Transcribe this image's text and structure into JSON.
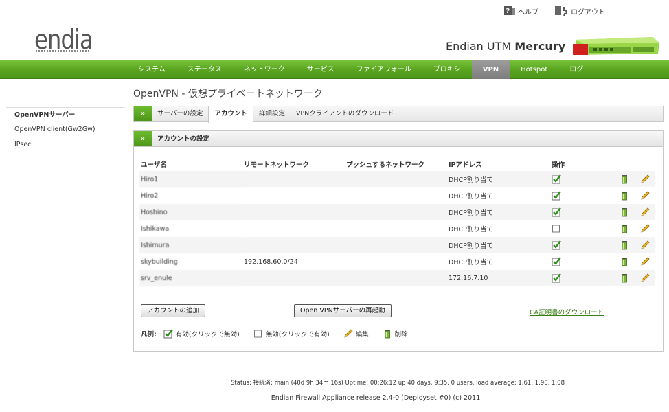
{
  "header": {
    "help_label": "ヘルプ",
    "logout_label": "ログアウト",
    "logo_text": "endian",
    "product_prefix": "Endian UTM",
    "product_name": "Mercury"
  },
  "nav": {
    "items": [
      {
        "label": "システム"
      },
      {
        "label": "ステータス"
      },
      {
        "label": "ネットワーク"
      },
      {
        "label": "サービス"
      },
      {
        "label": "ファイアウォール"
      },
      {
        "label": "プロキシ"
      },
      {
        "label": "VPN",
        "active": true
      },
      {
        "label": "Hotspot"
      },
      {
        "label": "ログ"
      }
    ]
  },
  "page_title": "OpenVPN - 仮想プライベートネットワーク",
  "sidebar": {
    "items": [
      {
        "label": "OpenVPNサーバー",
        "active": true
      },
      {
        "label": "OpenVPN client(Gw2Gw)"
      },
      {
        "label": "IPsec"
      }
    ]
  },
  "tabs": {
    "arrow": "»",
    "items": [
      {
        "label": "サーバーの設定"
      },
      {
        "label": "アカウント",
        "active": true
      },
      {
        "label": "詳細設定"
      },
      {
        "label": "VPNクライアントのダウンロード"
      }
    ]
  },
  "panel": {
    "title": "アカウントの設定",
    "columns": [
      "ユーザ名",
      "リモートネットワーク",
      "プッシュするネットワーク",
      "IPアドレス",
      "操作"
    ],
    "rows": [
      {
        "user": "Hiro1",
        "remote": "",
        "push": "",
        "ip": "DHCP割り当て",
        "enabled": true
      },
      {
        "user": "Hiro2",
        "remote": "",
        "push": "",
        "ip": "DHCP割り当て",
        "enabled": true
      },
      {
        "user": "Hoshino",
        "remote": "",
        "push": "",
        "ip": "DHCP割り当て",
        "enabled": true
      },
      {
        "user": "Ishikawa",
        "remote": "",
        "push": "",
        "ip": "DHCP割り当て",
        "enabled": false
      },
      {
        "user": "Ishimura",
        "remote": "",
        "push": "",
        "ip": "DHCP割り当て",
        "enabled": true
      },
      {
        "user": "skybuilding",
        "remote": "192.168.60.0/24",
        "push": "",
        "ip": "DHCP割り当て",
        "enabled": true
      },
      {
        "user": "srv_enule",
        "remote": "",
        "push": "",
        "ip": "172.16.7.10",
        "enabled": true
      }
    ],
    "add_button": "アカウントの追加",
    "restart_button": "Open VPNサーバーの再起動",
    "ca_link": "CA証明書のダウンロード",
    "legend": {
      "title": "凡例:",
      "enabled": "有効(クリックで無効)",
      "disabled": "無効(クリックで有効)",
      "edit": "編集",
      "delete": "削除"
    }
  },
  "status_line": "Status: 接続済: main (40d 9h 34m 16s) Uptime: 00:26:12 up 40 days, 9:35, 0 users, load average: 1.61, 1.90, 1.08",
  "footer": "Endian Firewall Appliance release 2.4-0 (Deployset #0) (c) 2011",
  "colors": {
    "nav_green": "#5aa521",
    "link_green": "#3a7d16",
    "active_tab_gray": "#8a8a8a"
  }
}
